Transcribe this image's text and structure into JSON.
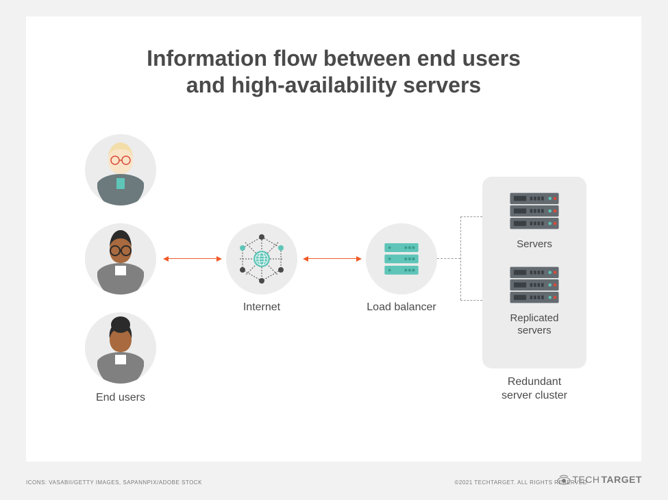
{
  "title_line1": "Information flow between end users",
  "title_line2": "and high-availability servers",
  "labels": {
    "end_users": "End users",
    "internet": "Internet",
    "load_balancer": "Load balancer",
    "servers": "Servers",
    "replicated_servers": "Replicated\nservers",
    "redundant_cluster": "Redundant\nserver cluster"
  },
  "footer": {
    "icons_credit": "ICONS: VASABII/GETTY IMAGES, SAPANNPIX/ADOBE STOCK",
    "copyright": "©2021 TECHTARGET. ALL RIGHTS RESERVED",
    "brand_prefix": "Tech",
    "brand_suffix": "Target"
  },
  "colors": {
    "accent_teal": "#5fc5b8",
    "accent_orange": "#f05a28",
    "panel_grey": "#ececec"
  }
}
